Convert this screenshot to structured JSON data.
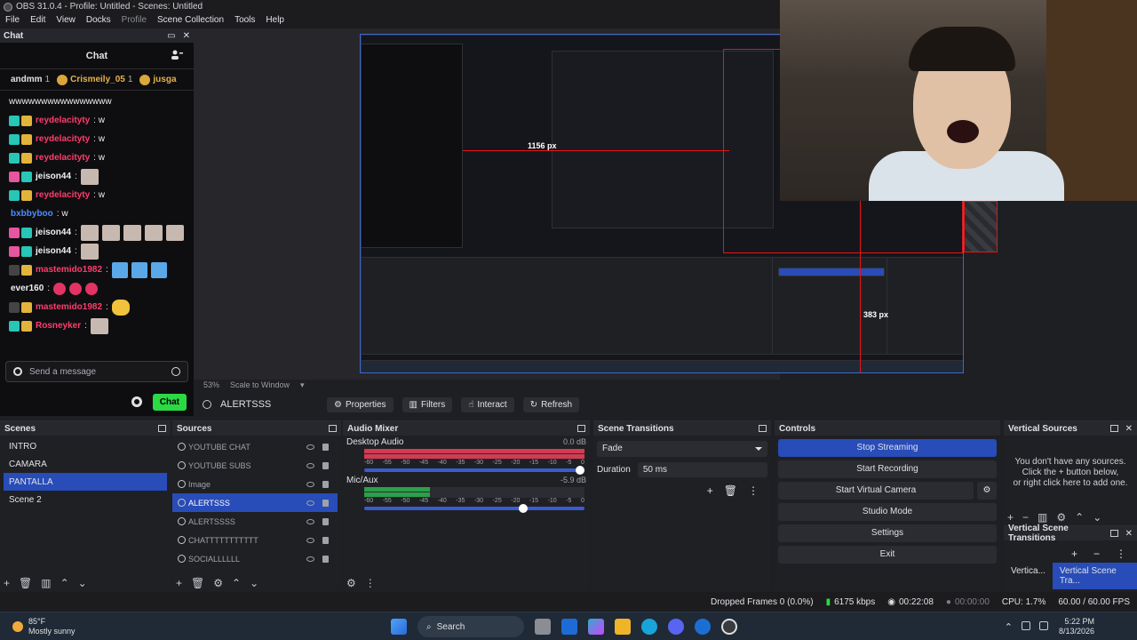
{
  "window": {
    "title": "OBS 31.0.4 - Profile: Untitled - Scenes: Untitled"
  },
  "menu": [
    "File",
    "Edit",
    "View",
    "Docks",
    "Profile",
    "Scene Collection",
    "Tools",
    "Help"
  ],
  "chat_dock": {
    "dock_title": "Chat",
    "header": "Chat",
    "leaderboard": [
      {
        "name": "andmm",
        "count": "1"
      },
      {
        "name": "Crismeily_05",
        "count": "1"
      },
      {
        "name": "jusga",
        "count": ""
      }
    ],
    "messages": [
      {
        "user": "",
        "text": "wwwwwwwwwwwwwwww",
        "badges": [],
        "user_color": "#efeff1",
        "emotes": []
      },
      {
        "user": "reydelacityty",
        "text": ": w",
        "badges": [
          "sub",
          "crown"
        ],
        "user_color": "#ff3c6e",
        "emotes": []
      },
      {
        "user": "reydelacityty",
        "text": ": w",
        "badges": [
          "sub",
          "crown"
        ],
        "user_color": "#ff3c6e",
        "emotes": []
      },
      {
        "user": "reydelacityty",
        "text": ": w",
        "badges": [
          "sub",
          "crown"
        ],
        "user_color": "#ff3c6e",
        "emotes": []
      },
      {
        "user": "jeison44",
        "text": ":",
        "badges": [
          "pink",
          "sub"
        ],
        "user_color": "#efeff1",
        "emotes": [
          "face"
        ]
      },
      {
        "user": "reydelacityty",
        "text": ": w",
        "badges": [
          "sub",
          "crown"
        ],
        "user_color": "#ff3c6e",
        "emotes": []
      },
      {
        "user": "bxbbyboo",
        "text": ": w",
        "badges": [],
        "user_color": "#4d8dff",
        "emotes": []
      },
      {
        "user": "jeison44",
        "text": ":",
        "badges": [
          "pink",
          "sub"
        ],
        "user_color": "#efeff1",
        "emotes": [
          "face",
          "face",
          "face",
          "face",
          "face"
        ]
      },
      {
        "user": "jeison44",
        "text": ":",
        "badges": [
          "pink",
          "sub"
        ],
        "user_color": "#efeff1",
        "emotes": [
          "face"
        ]
      },
      {
        "user": "mastemido1982",
        "text": ":",
        "badges": [
          "round",
          "crown"
        ],
        "user_color": "#ff3c6e",
        "emotes": [
          "blue",
          "blue",
          "blue"
        ]
      },
      {
        "user": "ever160",
        "text": ":",
        "badges": [],
        "user_color": "#efeff1",
        "emotes": [
          "red",
          "red",
          "red"
        ]
      },
      {
        "user": "mastemido1982",
        "text": ":",
        "badges": [
          "round",
          "crown"
        ],
        "user_color": "#ff3c6e",
        "emotes": [
          "yellow"
        ]
      },
      {
        "user": "Rosneyker",
        "text": ":",
        "badges": [
          "sub",
          "crown"
        ],
        "user_color": "#ff3c6e",
        "emotes": [
          "face"
        ]
      }
    ],
    "input_placeholder": "Send a message",
    "send_label": "Chat"
  },
  "preview": {
    "measure_1": "1156 px",
    "measure_2": "383 px",
    "zoom": "53%",
    "zoom_mode": "Scale to Window"
  },
  "source_toolbar": {
    "source_name": "ALERTSSS",
    "buttons": [
      "Properties",
      "Filters",
      "Interact",
      "Refresh"
    ]
  },
  "scenes": {
    "title": "Scenes",
    "items": [
      "INTRO",
      "CAMARA",
      "PANTALLA",
      "Scene 2"
    ],
    "selected": 2
  },
  "sources": {
    "title": "Sources",
    "items": [
      "YOUTUBE CHAT",
      "YOUTUBE SUBS",
      "Image",
      "ALERTSSS",
      "ALERTSSSS",
      "CHATTTTTTTTTTT",
      "SOCIALLLLLL"
    ],
    "selected": 3
  },
  "audio_mixer": {
    "title": "Audio Mixer",
    "channels": [
      {
        "name": "Desktop Audio",
        "db": "0.0 dB",
        "level_green": 0.0,
        "level_red": 1.0,
        "volume": 1.0
      },
      {
        "name": "Mic/Aux",
        "db": "-5.9 dB",
        "level_green": 0.3,
        "level_red": 0.0,
        "volume": 0.73
      }
    ],
    "ticks": [
      "-60",
      "-55",
      "-50",
      "-45",
      "-40",
      "-35",
      "-30",
      "-25",
      "-20",
      "-15",
      "-10",
      "-5",
      "0"
    ]
  },
  "scene_transitions": {
    "title": "Scene Transitions",
    "transition": "Fade",
    "duration_label": "Duration",
    "duration_value": "50 ms"
  },
  "controls": {
    "title": "Controls",
    "buttons": [
      "Stop Streaming",
      "Start Recording",
      "Start Virtual Camera",
      "Studio Mode",
      "Settings",
      "Exit"
    ]
  },
  "vertical_sources": {
    "title": "Vertical Sources",
    "empty_text_1": "You don't have any sources.",
    "empty_text_2": "Click the + button below,",
    "empty_text_3": "or right click here to add one."
  },
  "vertical_scene_transitions": {
    "title": "Vertical Scene Transitions",
    "tabs": [
      "Vertica...",
      "Vertical Scene Tra..."
    ]
  },
  "status_bar": {
    "dropped_frames": "Dropped Frames 0 (0.0%)",
    "bitrate": "6175 kbps",
    "stream_time": "00:22:08",
    "record_time": "00:00:00",
    "cpu": "CPU: 1.7%",
    "fps": "60.00 / 60.00 FPS"
  },
  "taskbar": {
    "temperature": "85°F",
    "weather": "Mostly sunny",
    "search": "Search",
    "time": "5:22 PM",
    "date": "8/13/2026"
  },
  "colors": {
    "accent": "#284cb8",
    "chat_send": "#2bd944",
    "measure_line": "#e81414"
  }
}
